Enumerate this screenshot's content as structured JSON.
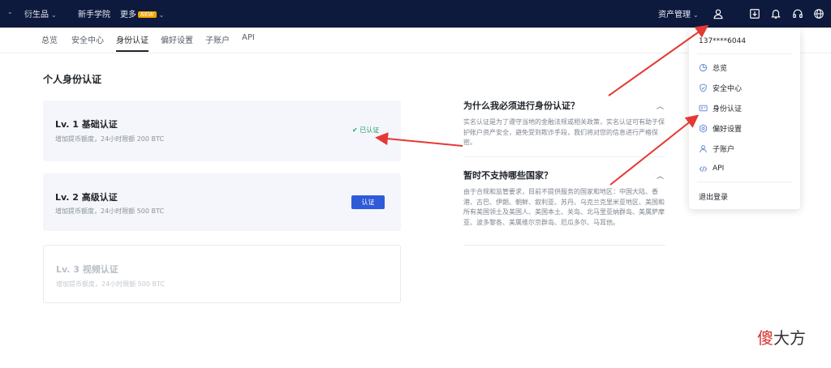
{
  "topbar": {
    "menu_left": [
      {
        "label": "衍生品",
        "caret": true
      },
      {
        "label": "新手学院",
        "caret": false
      },
      {
        "label": "更多",
        "badge": "NEW",
        "caret": true
      }
    ],
    "asset_mgmt": "资产管理"
  },
  "tabs": [
    {
      "label": "总览",
      "active": false
    },
    {
      "label": "安全中心",
      "active": false
    },
    {
      "label": "身份认证",
      "active": true
    },
    {
      "label": "偏好设置",
      "active": false
    },
    {
      "label": "子账户",
      "active": false
    },
    {
      "label": "API",
      "active": false
    }
  ],
  "page_title": "个人身份认证",
  "levels": {
    "lv1": {
      "title": "Lv. 1 基础认证",
      "desc": "增加提币额度，24小时限额 200 BTC",
      "status": "已认证"
    },
    "lv2": {
      "title": "Lv. 2 高级认证",
      "desc": "增加提币额度，24小时限额 500 BTC",
      "button": "认证"
    },
    "lv3": {
      "title": "Lv. 3 视频认证",
      "desc": "增加提币额度，24小时限额 500 BTC"
    }
  },
  "faq": {
    "q1": {
      "question": "为什么我必须进行身份认证？",
      "answer": "实名认证是为了遵守当地的金融法规或相关政策，实名认证可有助于保护账户资产安全，避免受到欺诈手段，我们将对您的信息进行严格保密。"
    },
    "q2": {
      "question": "暂时不支持哪些国家？",
      "answer": "由于合规和监管要求，目前不提供服务的国家和地区：中国大陆、香港、古巴、伊朗、朝鲜、叙利亚、苏丹、乌克兰克里米亚地区、美国和所有美国领土及美国人、美国本土、关岛、北马里亚纳群岛、美属萨摩亚、波多黎各、美属维尔京群岛、厄瓜多尔、马耳他。"
    }
  },
  "dropdown": {
    "user": "137****6044",
    "items": [
      {
        "label": "总览",
        "icon": "overview-icon"
      },
      {
        "label": "安全中心",
        "icon": "shield-icon"
      },
      {
        "label": "身份认证",
        "icon": "id-card-icon"
      },
      {
        "label": "偏好设置",
        "icon": "settings-icon"
      },
      {
        "label": "子账户",
        "icon": "user-icon"
      },
      {
        "label": "API",
        "icon": "code-icon"
      }
    ],
    "logout": "退出登录"
  },
  "watermark": {
    "part1": "傻",
    "part2": "大方"
  },
  "colors": {
    "topbar": "#0d1a3d",
    "accent": "#2f5bd8",
    "success": "#22a06b",
    "arrow": "#e53935"
  }
}
